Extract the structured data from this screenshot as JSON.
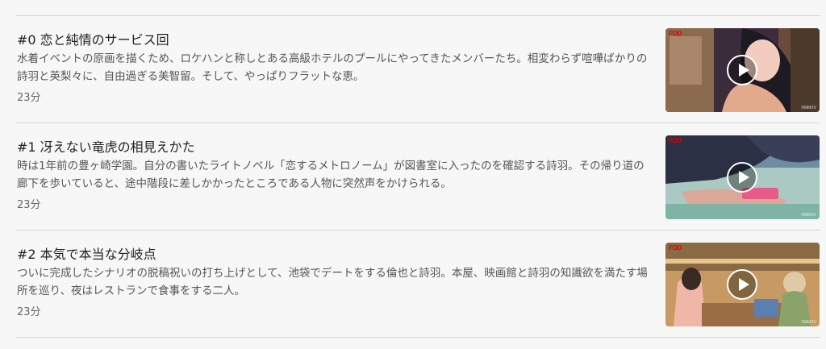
{
  "episodes": [
    {
      "title": "#0 恋と純情のサービス回",
      "description": "水着イベントの原画を描くため、ロケハンと称しとある高級ホテルのプールにやってきたメンバーたち。相変わらず喧嘩ばかりの詩羽と英梨々に、自由過ぎる美智留。そして、やっぱりフラットな恵。",
      "duration": "23分",
      "badge": "FOD",
      "watermark": "©MMXV",
      "icon": "play-icon"
    },
    {
      "title": "#1 冴えない竜虎の相見えかた",
      "description": "時は1年前の豊ヶ崎学園。自分の書いたライトノベル「恋するメトロノーム」が図書室に入ったのを確認する詩羽。その帰り道の廊下を歩いていると、途中階段に差しかかったところである人物に突然声をかけられる。",
      "duration": "23分",
      "badge": "FOD",
      "watermark": "©MMXV",
      "icon": "play-icon"
    },
    {
      "title": "#2 本気で本当な分岐点",
      "description": "ついに完成したシナリオの脱稿祝いの打ち上げとして、池袋でデートをする倫也と詩羽。本屋、映画館と詩羽の知識欲を満たす場所を巡り、夜はレストランで食事をする二人。",
      "duration": "23分",
      "badge": "FOD",
      "watermark": "©MMXV",
      "icon": "play-icon"
    }
  ]
}
